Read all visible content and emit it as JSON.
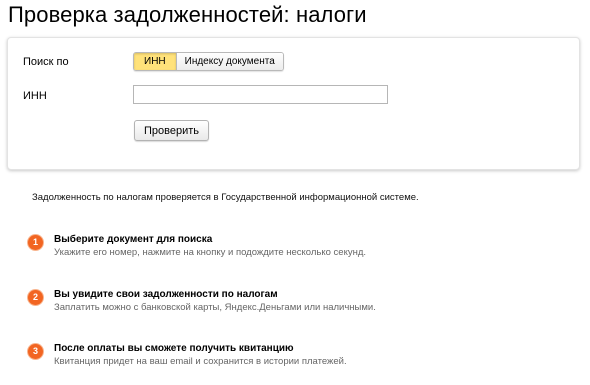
{
  "page": {
    "title": "Проверка задолженностей: налоги"
  },
  "form": {
    "search_by_label": "Поиск по",
    "search_options": [
      "ИНН",
      "Индексу документа"
    ],
    "selected_option": "ИНН",
    "inn_label": "ИНН",
    "inn_value": "",
    "inn_placeholder": "",
    "submit_label": "Проверить"
  },
  "info": {
    "text": "Задолженность по налогам проверяется в Государственной информационной системе."
  },
  "steps": [
    {
      "number": "1",
      "title": "Выберите документ для поиска",
      "description": "Укажите его номер, нажмите на кнопку и подождите несколько секунд."
    },
    {
      "number": "2",
      "title": "Вы увидите свои задолженности по налогам",
      "description": "Заплатить можно с банковской карты, Яндекс.Деньгами или наличными."
    },
    {
      "number": "3",
      "title": "После оплаты вы сможете получить квитанцию",
      "description": "Квитанция придет на ваш email и сохранится в истории платежей."
    }
  ],
  "colors": {
    "active_option": "#ffe27a",
    "step_badge": "#f26522"
  }
}
